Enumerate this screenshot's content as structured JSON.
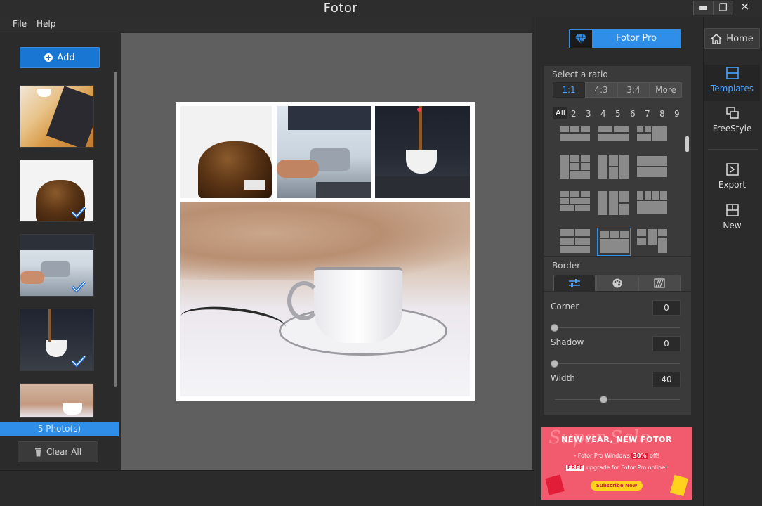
{
  "window": {
    "title": "Fotor",
    "minimize": "▬",
    "maximize": "❐",
    "close": "✕"
  },
  "menu": {
    "items": [
      {
        "label": "File"
      },
      {
        "label": "Help"
      }
    ]
  },
  "left_panel": {
    "add_label": "Add",
    "photo_count": "5 Photo(s)",
    "clear_all_label": "Clear All"
  },
  "right_panel": {
    "pro_label": "Fotor Pro",
    "ratio": {
      "label": "Select a ratio",
      "options": [
        {
          "label": "1:1"
        },
        {
          "label": "4:3"
        },
        {
          "label": "3:4"
        },
        {
          "label": "More"
        }
      ],
      "selected": "1:1"
    },
    "count_filters": [
      "All",
      "2",
      "3",
      "4",
      "5",
      "6",
      "7",
      "8",
      "9"
    ],
    "border": {
      "label": "Border",
      "corner": {
        "label": "Corner",
        "value": "0",
        "level": 0
      },
      "shadow": {
        "label": "Shadow",
        "value": "0",
        "level": 0
      },
      "width": {
        "label": "Width",
        "value": "40",
        "level": 0.4
      }
    },
    "promo": {
      "title": "NEW YEAR, NEW FOTOR",
      "script_text": "Super Sale",
      "line1_pre": "- Fotor Pro Windows ",
      "line1_badge": "30%",
      "line1_post": " off!",
      "line2_badge": "FREE",
      "line2_post": " upgrade for Fotor Pro online!",
      "cta": "Subscribe Now"
    }
  },
  "toolbar": {
    "home_label": "Home",
    "tools": [
      {
        "label": "Templates"
      },
      {
        "label": "FreeStyle"
      },
      {
        "label": "Export"
      },
      {
        "label": "New"
      }
    ]
  },
  "colors": {
    "accent": "#2f8fe8",
    "panel": "#3a3a3a",
    "background": "#2b2b2b",
    "canvas": "#5f5f5f"
  }
}
